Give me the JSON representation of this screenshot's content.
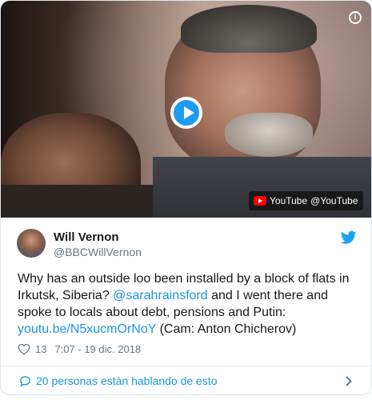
{
  "video": {
    "info_icon": "info-icon",
    "play_icon": "play-icon",
    "badge": {
      "logo": "youtube-logo-icon",
      "text": "YouTube",
      "handle": "@YouTube"
    }
  },
  "author": {
    "name": "Will Vernon",
    "handle": "@BBCWillVernon",
    "avatar": "avatar"
  },
  "tweet": {
    "text_part1": "Why has an outside loo been installed by a block of flats in Irkutsk, Siberia? ",
    "mention": "@sarahrainsford",
    "text_part2": " and I went there and spoke to locals about debt, pensions and Putin: ",
    "link": "youtu.be/N5xucmOrNoY",
    "text_part3": "  (Cam: Anton Chicherov)"
  },
  "meta": {
    "likes": "13",
    "time": "7:07 - 19 dic. 2018"
  },
  "footer": {
    "talking_label": "20 personas están hablando de esto"
  },
  "colors": {
    "accent": "#1b95e0",
    "muted": "#657786",
    "text": "#14171a"
  }
}
